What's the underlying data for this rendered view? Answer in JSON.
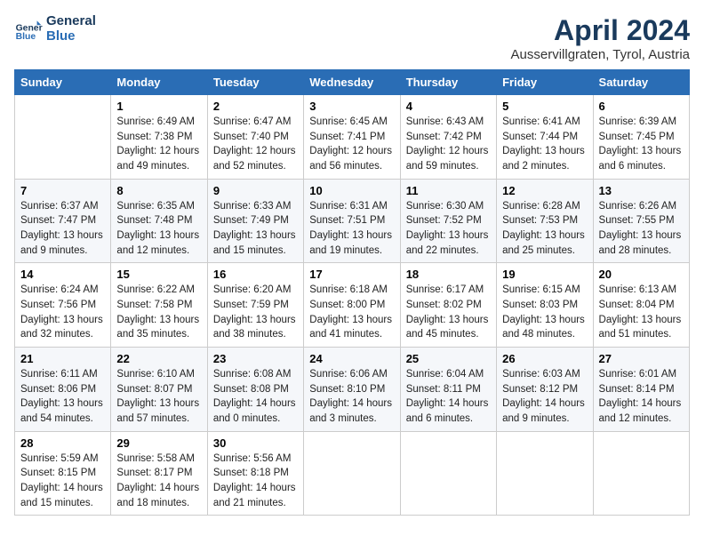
{
  "header": {
    "logo_line1": "General",
    "logo_line2": "Blue",
    "title": "April 2024",
    "subtitle": "Ausservillgraten, Tyrol, Austria"
  },
  "days_of_week": [
    "Sunday",
    "Monday",
    "Tuesday",
    "Wednesday",
    "Thursday",
    "Friday",
    "Saturday"
  ],
  "weeks": [
    [
      {
        "day": "",
        "content": ""
      },
      {
        "day": "1",
        "content": "Sunrise: 6:49 AM\nSunset: 7:38 PM\nDaylight: 12 hours\nand 49 minutes."
      },
      {
        "day": "2",
        "content": "Sunrise: 6:47 AM\nSunset: 7:40 PM\nDaylight: 12 hours\nand 52 minutes."
      },
      {
        "day": "3",
        "content": "Sunrise: 6:45 AM\nSunset: 7:41 PM\nDaylight: 12 hours\nand 56 minutes."
      },
      {
        "day": "4",
        "content": "Sunrise: 6:43 AM\nSunset: 7:42 PM\nDaylight: 12 hours\nand 59 minutes."
      },
      {
        "day": "5",
        "content": "Sunrise: 6:41 AM\nSunset: 7:44 PM\nDaylight: 13 hours\nand 2 minutes."
      },
      {
        "day": "6",
        "content": "Sunrise: 6:39 AM\nSunset: 7:45 PM\nDaylight: 13 hours\nand 6 minutes."
      }
    ],
    [
      {
        "day": "7",
        "content": "Sunrise: 6:37 AM\nSunset: 7:47 PM\nDaylight: 13 hours\nand 9 minutes."
      },
      {
        "day": "8",
        "content": "Sunrise: 6:35 AM\nSunset: 7:48 PM\nDaylight: 13 hours\nand 12 minutes."
      },
      {
        "day": "9",
        "content": "Sunrise: 6:33 AM\nSunset: 7:49 PM\nDaylight: 13 hours\nand 15 minutes."
      },
      {
        "day": "10",
        "content": "Sunrise: 6:31 AM\nSunset: 7:51 PM\nDaylight: 13 hours\nand 19 minutes."
      },
      {
        "day": "11",
        "content": "Sunrise: 6:30 AM\nSunset: 7:52 PM\nDaylight: 13 hours\nand 22 minutes."
      },
      {
        "day": "12",
        "content": "Sunrise: 6:28 AM\nSunset: 7:53 PM\nDaylight: 13 hours\nand 25 minutes."
      },
      {
        "day": "13",
        "content": "Sunrise: 6:26 AM\nSunset: 7:55 PM\nDaylight: 13 hours\nand 28 minutes."
      }
    ],
    [
      {
        "day": "14",
        "content": "Sunrise: 6:24 AM\nSunset: 7:56 PM\nDaylight: 13 hours\nand 32 minutes."
      },
      {
        "day": "15",
        "content": "Sunrise: 6:22 AM\nSunset: 7:58 PM\nDaylight: 13 hours\nand 35 minutes."
      },
      {
        "day": "16",
        "content": "Sunrise: 6:20 AM\nSunset: 7:59 PM\nDaylight: 13 hours\nand 38 minutes."
      },
      {
        "day": "17",
        "content": "Sunrise: 6:18 AM\nSunset: 8:00 PM\nDaylight: 13 hours\nand 41 minutes."
      },
      {
        "day": "18",
        "content": "Sunrise: 6:17 AM\nSunset: 8:02 PM\nDaylight: 13 hours\nand 45 minutes."
      },
      {
        "day": "19",
        "content": "Sunrise: 6:15 AM\nSunset: 8:03 PM\nDaylight: 13 hours\nand 48 minutes."
      },
      {
        "day": "20",
        "content": "Sunrise: 6:13 AM\nSunset: 8:04 PM\nDaylight: 13 hours\nand 51 minutes."
      }
    ],
    [
      {
        "day": "21",
        "content": "Sunrise: 6:11 AM\nSunset: 8:06 PM\nDaylight: 13 hours\nand 54 minutes."
      },
      {
        "day": "22",
        "content": "Sunrise: 6:10 AM\nSunset: 8:07 PM\nDaylight: 13 hours\nand 57 minutes."
      },
      {
        "day": "23",
        "content": "Sunrise: 6:08 AM\nSunset: 8:08 PM\nDaylight: 14 hours\nand 0 minutes."
      },
      {
        "day": "24",
        "content": "Sunrise: 6:06 AM\nSunset: 8:10 PM\nDaylight: 14 hours\nand 3 minutes."
      },
      {
        "day": "25",
        "content": "Sunrise: 6:04 AM\nSunset: 8:11 PM\nDaylight: 14 hours\nand 6 minutes."
      },
      {
        "day": "26",
        "content": "Sunrise: 6:03 AM\nSunset: 8:12 PM\nDaylight: 14 hours\nand 9 minutes."
      },
      {
        "day": "27",
        "content": "Sunrise: 6:01 AM\nSunset: 8:14 PM\nDaylight: 14 hours\nand 12 minutes."
      }
    ],
    [
      {
        "day": "28",
        "content": "Sunrise: 5:59 AM\nSunset: 8:15 PM\nDaylight: 14 hours\nand 15 minutes."
      },
      {
        "day": "29",
        "content": "Sunrise: 5:58 AM\nSunset: 8:17 PM\nDaylight: 14 hours\nand 18 minutes."
      },
      {
        "day": "30",
        "content": "Sunrise: 5:56 AM\nSunset: 8:18 PM\nDaylight: 14 hours\nand 21 minutes."
      },
      {
        "day": "",
        "content": ""
      },
      {
        "day": "",
        "content": ""
      },
      {
        "day": "",
        "content": ""
      },
      {
        "day": "",
        "content": ""
      }
    ]
  ]
}
